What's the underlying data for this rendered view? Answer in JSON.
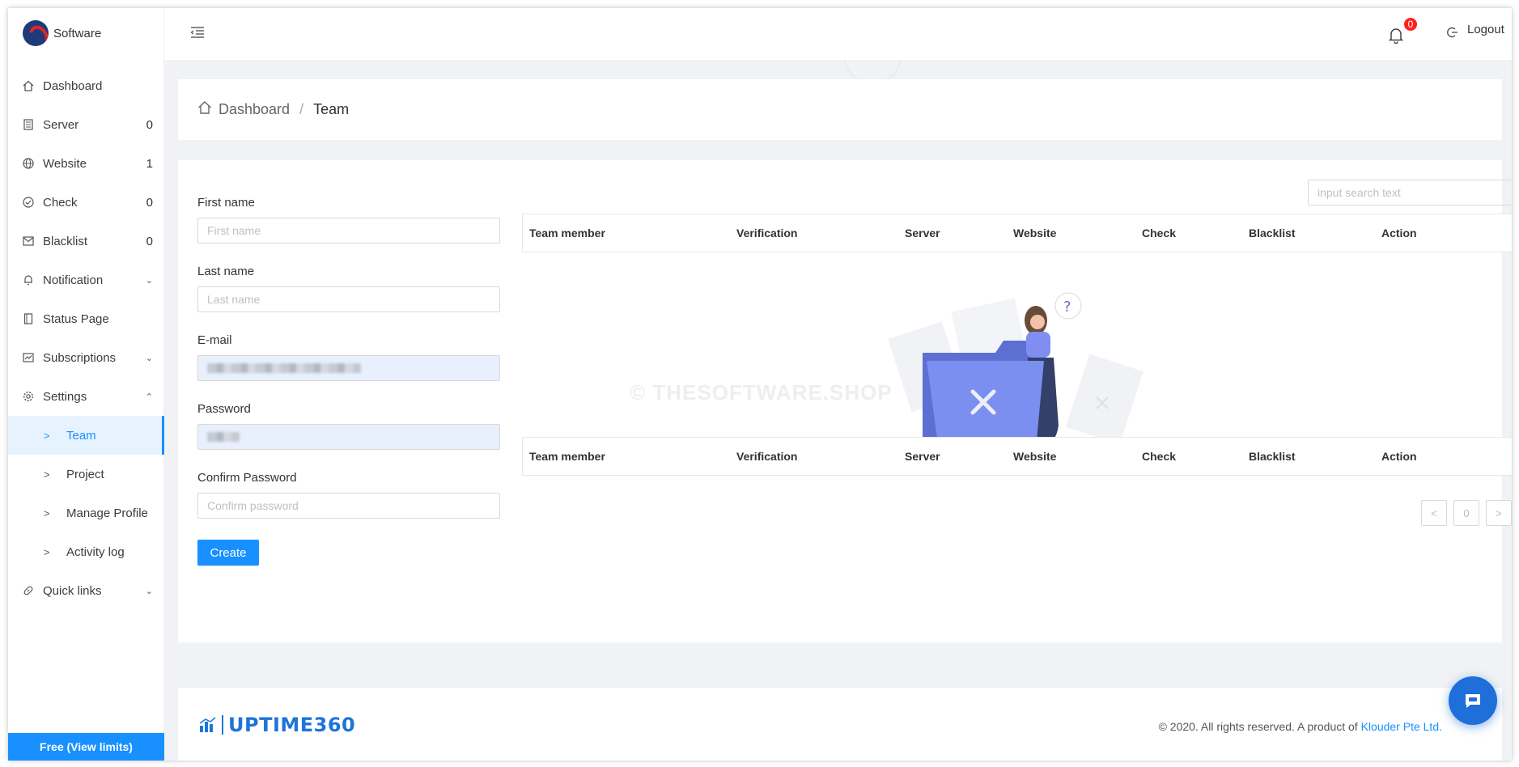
{
  "brand": {
    "name": "Software"
  },
  "sidebar": {
    "items": [
      {
        "label": "Dashboard",
        "count": "",
        "icon": "home-icon"
      },
      {
        "label": "Server",
        "count": "0",
        "icon": "server-icon"
      },
      {
        "label": "Website",
        "count": "1",
        "icon": "globe-icon"
      },
      {
        "label": "Check",
        "count": "0",
        "icon": "check-circle-icon"
      },
      {
        "label": "Blacklist",
        "count": "0",
        "icon": "mail-icon"
      },
      {
        "label": "Notification",
        "count": "",
        "icon": "bell-icon"
      },
      {
        "label": "Status Page",
        "count": "",
        "icon": "book-icon"
      },
      {
        "label": "Subscriptions",
        "count": "",
        "icon": "chart-icon"
      },
      {
        "label": "Settings",
        "count": "",
        "icon": "gear-icon"
      }
    ],
    "settings_sub": [
      {
        "label": "Team",
        "active": true
      },
      {
        "label": "Project",
        "active": false
      },
      {
        "label": "Manage Profile",
        "active": false
      },
      {
        "label": "Activity log",
        "active": false
      }
    ],
    "quick_links": "Quick links",
    "free_label": "Free (View limits)"
  },
  "header": {
    "notification_count": "0",
    "logout_label": "Logout"
  },
  "breadcrumb": {
    "home": "Dashboard",
    "separator": "/",
    "current": "Team"
  },
  "form": {
    "first_name_label": "First name",
    "first_name_placeholder": "First name",
    "last_name_label": "Last name",
    "last_name_placeholder": "Last name",
    "email_label": "E-mail",
    "password_label": "Password",
    "confirm_label": "Confirm Password",
    "confirm_placeholder": "Confirm password",
    "create_label": "Create"
  },
  "search": {
    "placeholder": "input search text"
  },
  "table": {
    "columns": [
      "Team member",
      "Verification",
      "Server",
      "Website",
      "Check",
      "Blacklist",
      "Action"
    ]
  },
  "pagination": {
    "page": "0"
  },
  "footer": {
    "logo_text": "UPTIME360",
    "copyright": "© 2020. All rights reserved. A product of ",
    "company": "Klouder Pte Ltd."
  },
  "watermark": "© THESOFTWARE.SHOP",
  "colors": {
    "accent": "#1890ff",
    "badge": "#ff1f1f",
    "folder": "#7b8ff0"
  }
}
